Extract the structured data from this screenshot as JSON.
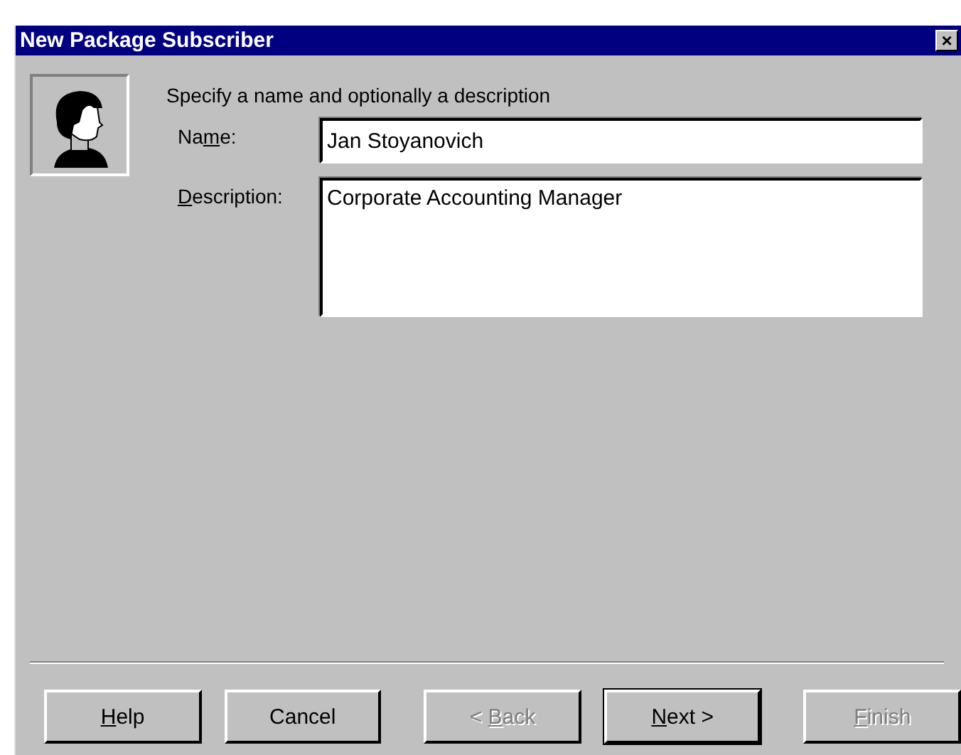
{
  "window": {
    "title": "New Package Subscriber",
    "close": "×"
  },
  "instruction": "Specify a name and optionally a description",
  "fields": [
    {
      "kind": "line",
      "label": {
        "pre": "Na",
        "key": "m",
        "post": "e:"
      },
      "value": "Jan Stoyanovich"
    },
    {
      "kind": "area",
      "label": {
        "key": "D",
        "post": "escription:"
      },
      "value": "Corporate Accounting Manager"
    }
  ],
  "buttons": [
    {
      "label": {
        "key": "H",
        "post": "elp"
      },
      "disabled": false,
      "default": false
    },
    {
      "label": {
        "pre": "Cancel"
      },
      "disabled": false,
      "default": false
    },
    {
      "label": {
        "pre": "< ",
        "key": "B",
        "post": "ack"
      },
      "disabled": true,
      "default": false
    },
    {
      "label": {
        "key": "N",
        "post": "ext >"
      },
      "disabled": false,
      "default": true
    },
    {
      "label": {
        "key": "F",
        "post": "inish"
      },
      "disabled": true,
      "default": false
    }
  ]
}
